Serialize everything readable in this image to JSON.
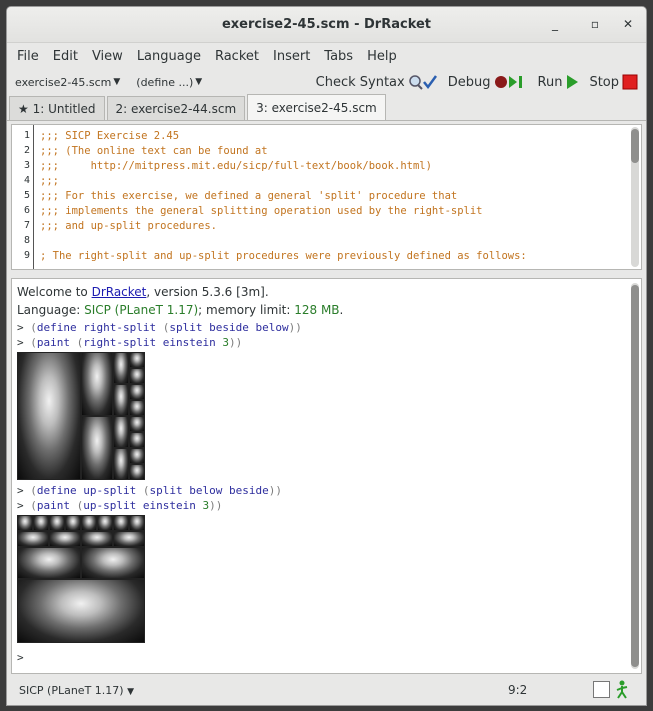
{
  "window": {
    "title": "exercise2-45.scm - DrRacket",
    "minimize": "_",
    "maximize": "▫",
    "close": "✕"
  },
  "menu": [
    "File",
    "Edit",
    "View",
    "Language",
    "Racket",
    "Insert",
    "Tabs",
    "Help"
  ],
  "toolbar": {
    "file_select": "exercise2-45.scm",
    "define_select": "(define ...)",
    "check_syntax": "Check Syntax",
    "debug": "Debug",
    "run": "Run",
    "stop": "Stop"
  },
  "tabs": [
    {
      "label": "★ 1: Untitled"
    },
    {
      "label": "2: exercise2-44.scm"
    },
    {
      "label": "3: exercise2-45.scm"
    }
  ],
  "definitions": {
    "lines": [
      {
        "num": "1",
        "text": ";;; SICP Exercise 2.45"
      },
      {
        "num": "2",
        "text": ";;; (The online text can be found at"
      },
      {
        "num": "3",
        "text": ";;;     http://mitpress.mit.edu/sicp/full-text/book/book.html)"
      },
      {
        "num": "4",
        "text": ";;;"
      },
      {
        "num": "5",
        "text": ";;; For this exercise, we defined a general 'split' procedure that"
      },
      {
        "num": "6",
        "text": ";;; implements the general splitting operation used by the right-split"
      },
      {
        "num": "7",
        "text": ";;; and up-split procedures."
      },
      {
        "num": "8",
        "text": ""
      },
      {
        "num": "9",
        "text": "; The right-split and up-split procedures were previously defined as follows:"
      }
    ]
  },
  "interactions": {
    "welcome_prefix": "Welcome to ",
    "welcome_link": "DrRacket",
    "welcome_suffix": ", version 5.3.6 [3m].",
    "language_prefix": "Language: ",
    "language_name": "SICP (PLaneT 1.17)",
    "language_mid": "; memory limit: ",
    "memory_limit": "128 MB",
    "language_end": ".",
    "prompt": ">",
    "commands": [
      {
        "open": "(",
        "kw": "define",
        "sp": " ",
        "name": "right-split",
        "rest_open": " (",
        "kw2": "split",
        "args": " beside below",
        "close": "))"
      },
      {
        "open": "(",
        "kw": "paint",
        "sp": " ",
        "rest_open": "(",
        "kw2": "right-split",
        "args": " einstein ",
        "num": "3",
        "close": "))"
      },
      {
        "open": "(",
        "kw": "define",
        "sp": " ",
        "name": "up-split",
        "rest_open": " (",
        "kw2": "split",
        "args": " below beside",
        "close": "))"
      },
      {
        "open": "(",
        "kw": "paint",
        "sp": " ",
        "rest_open": "(",
        "kw2": "up-split",
        "args": " einstein ",
        "num": "3",
        "close": "))"
      }
    ]
  },
  "status": {
    "language": "SICP (PLaneT 1.17)",
    "position": "9:2"
  },
  "colors": {
    "comment": "#c2741f",
    "keyword": "#2e2e9e",
    "green": "#2a7d2a",
    "link": "#1c1cb0",
    "stop_red": "#e02020",
    "run_green": "#2a9d2a"
  }
}
